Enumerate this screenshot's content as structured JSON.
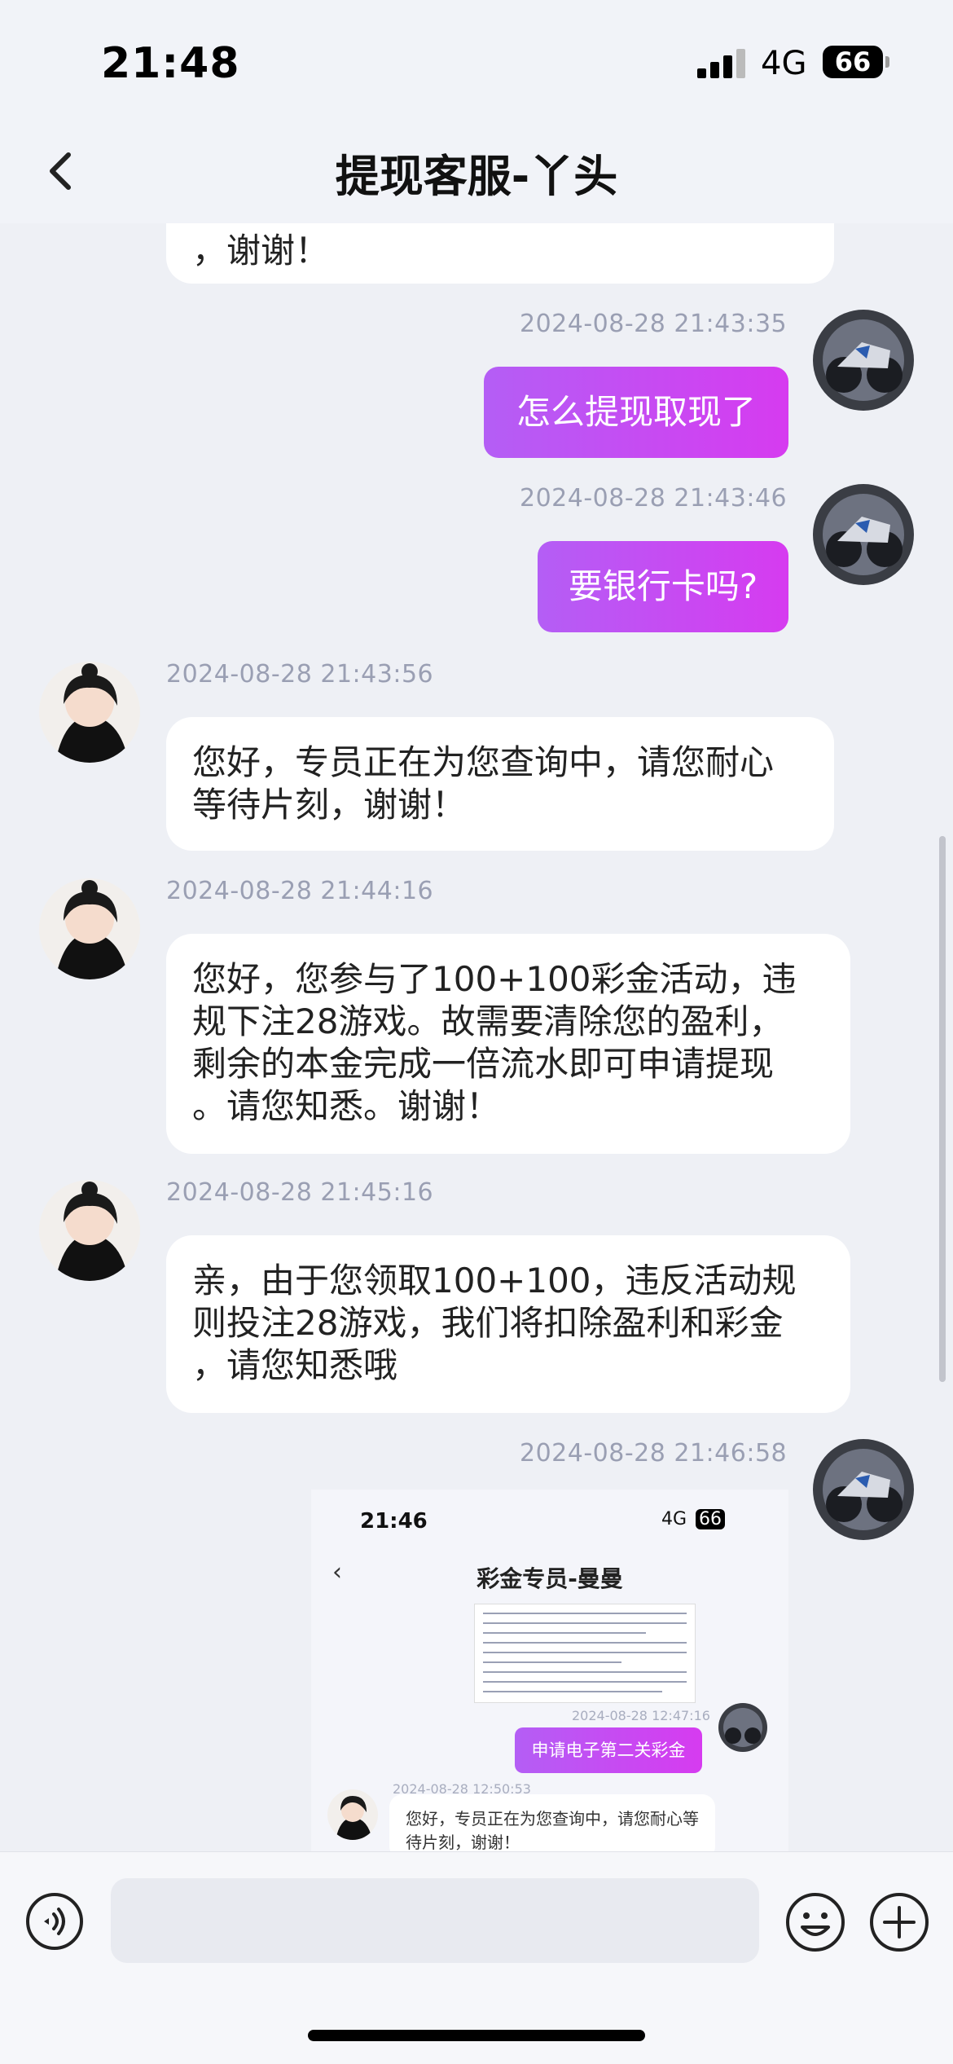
{
  "status_bar": {
    "time": "21:48",
    "network": "4G",
    "battery": "66"
  },
  "header": {
    "title": "提现客服-丫头",
    "back_icon": "chevron-left-icon"
  },
  "messages": [
    {
      "side": "left",
      "text": "，谢谢！",
      "partial": true
    },
    {
      "side": "right",
      "time": "2024-08-28 21:43:35",
      "text": "怎么提现取现了"
    },
    {
      "side": "right",
      "time": "2024-08-28 21:43:46",
      "text": "要银行卡吗?"
    },
    {
      "side": "left",
      "time": "2024-08-28 21:43:56",
      "text": "您好，专员正在为您查询中，请您耐心\n等待片刻，谢谢！"
    },
    {
      "side": "left",
      "time": "2024-08-28 21:44:16",
      "text": "您好，您参与了100+100彩金活动，违\n规下注28游戏。故需要清除您的盈利，\n剩余的本金完成一倍流水即可申请提现\n。请您知悉。谢谢！"
    },
    {
      "side": "left",
      "time": "2024-08-28 21:45:16",
      "text": "亲，由于您领取100+100，违反活动规\n则投注28游戏，我们将扣除盈利和彩金\n，请您知悉哦"
    },
    {
      "side": "right",
      "time": "2024-08-28 21:46:58",
      "type": "image"
    }
  ],
  "screenshot_message": {
    "time": "21:46",
    "network": "4G",
    "battery": "66",
    "title": "彩金专员-曼曼",
    "ts1": "2024-08-28 12:47:16",
    "button_text": "申请电子第二关彩金",
    "ts2": "2024-08-28 12:50:53",
    "reply_text": "您好，专员正在为您查询中，请您耐心等待片刻，谢谢！"
  },
  "input_bar": {
    "placeholder": "",
    "voice_icon": "voice-icon",
    "emoji_icon": "emoji-icon",
    "plus_icon": "plus-icon"
  },
  "colors": {
    "accent_gradient_start": "#b45ef5",
    "accent_gradient_end": "#d63bf0",
    "background": "#eef0f5"
  }
}
